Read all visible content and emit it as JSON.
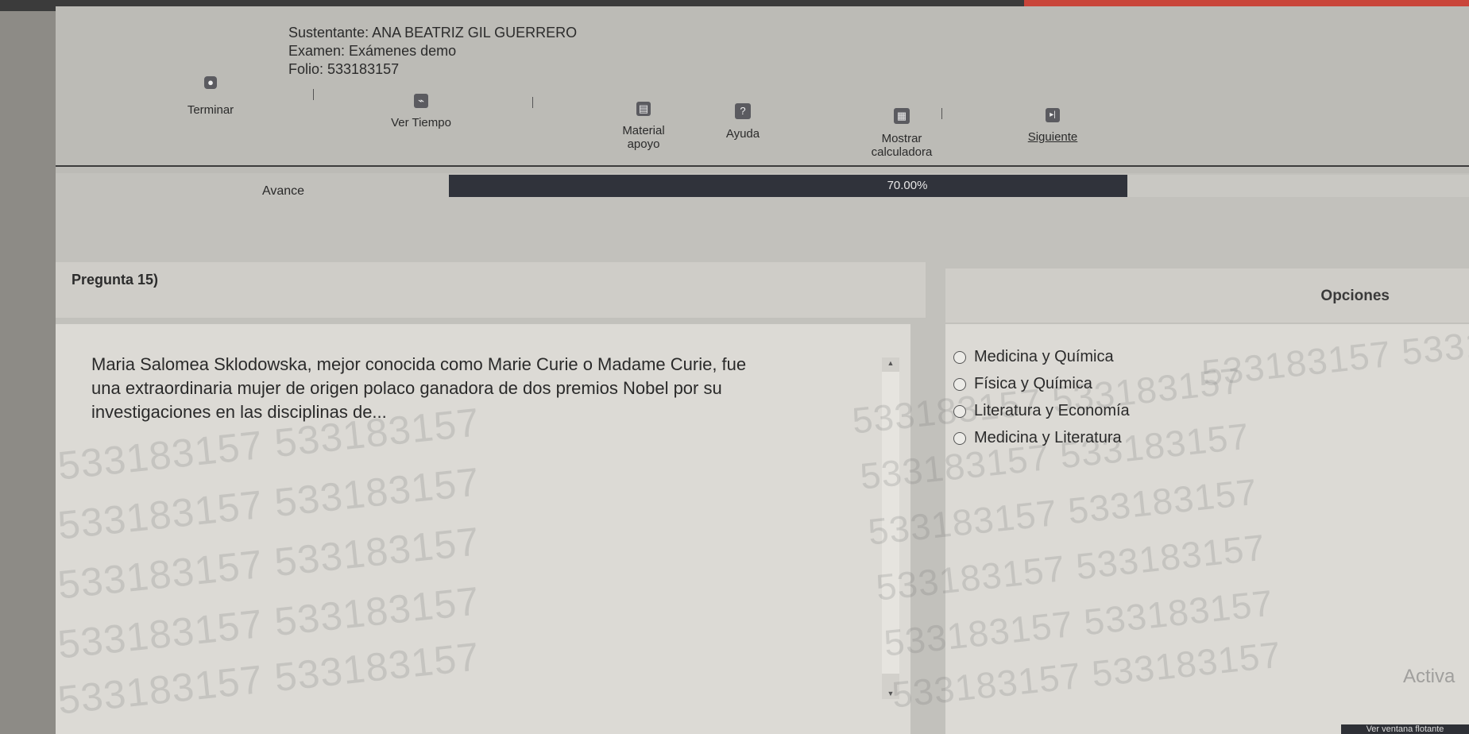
{
  "header": {
    "sustentante": "Sustentante: ANA BEATRIZ GIL GUERRERO",
    "examen": "Examen: Exámenes demo",
    "folio": "Folio: 533183157"
  },
  "toolbar": {
    "terminar": "Terminar",
    "ver_tiempo": "Ver Tiempo",
    "material_apoyo_1": "Material",
    "material_apoyo_2": "apoyo",
    "ayuda": "Ayuda",
    "ayuda_icon_glyph": "?",
    "mostrar_calc_1": "Mostrar",
    "mostrar_calc_2": "calculadora",
    "siguiente": "Siguiente"
  },
  "progress": {
    "label": "Avance",
    "percent_text": "70.00%",
    "fraction": 0.7
  },
  "question": {
    "title": "Pregunta 15)",
    "text": "Maria Salomea Sklodowska, mejor conocida como Marie Curie o Madame Curie, fue una extraordinaria mujer de origen polaco ganadora de dos premios Nobel por su investigaciones en las disciplinas de..."
  },
  "options": {
    "title": "Opciones",
    "items": [
      {
        "label": "Medicina y Química"
      },
      {
        "label": "Física y Química"
      },
      {
        "label": "Literatura y Economía"
      },
      {
        "label": "Medicina y Literatura"
      }
    ]
  },
  "watermark": "533183157 533183157",
  "floating": {
    "label": "Ver ventana flotante"
  },
  "os_overlay": "Activa",
  "colors": {
    "progress_fill": "#30333b",
    "background": "#c2c1bc",
    "panel": "#dcdad5"
  }
}
